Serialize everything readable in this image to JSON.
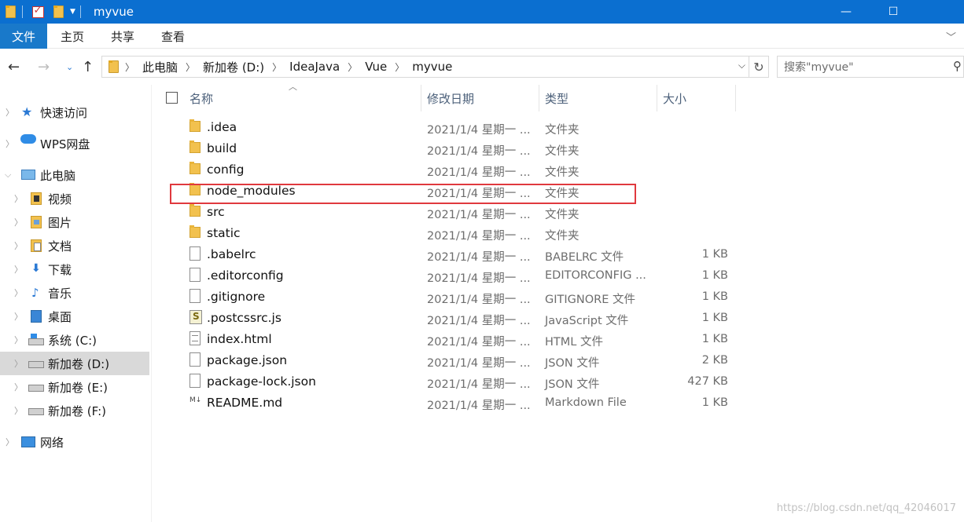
{
  "window": {
    "title": "myvue",
    "controls": {
      "minimize": "—",
      "maximize": "☐"
    }
  },
  "ribbon": {
    "tabs": [
      "文件",
      "主页",
      "共享",
      "查看"
    ]
  },
  "address": {
    "crumbs": [
      "此电脑",
      "新加卷 (D:)",
      "IdeaJava",
      "Vue",
      "myvue"
    ]
  },
  "search": {
    "placeholder": "搜索\"myvue\""
  },
  "nav": {
    "items": [
      {
        "label": "快速访问",
        "icon": "star-icon"
      },
      {
        "label": "WPS网盘",
        "icon": "cloud-icon"
      },
      {
        "label": "此电脑",
        "icon": "computer-icon"
      },
      {
        "label": "视频",
        "icon": "video-library-icon"
      },
      {
        "label": "图片",
        "icon": "picture-library-icon"
      },
      {
        "label": "文档",
        "icon": "document-library-icon"
      },
      {
        "label": "下载",
        "icon": "download-icon"
      },
      {
        "label": "音乐",
        "icon": "music-icon"
      },
      {
        "label": "桌面",
        "icon": "desktop-icon"
      },
      {
        "label": "系统 (C:)",
        "icon": "system-drive-icon"
      },
      {
        "label": "新加卷 (D:)",
        "icon": "drive-icon"
      },
      {
        "label": "新加卷 (E:)",
        "icon": "drive-icon"
      },
      {
        "label": "新加卷 (F:)",
        "icon": "drive-icon"
      },
      {
        "label": "网络",
        "icon": "network-icon"
      }
    ]
  },
  "columns": {
    "name": "名称",
    "date": "修改日期",
    "type": "类型",
    "size": "大小"
  },
  "files": [
    {
      "name": ".idea",
      "date": "2021/1/4 星期一 ...",
      "type": "文件夹",
      "size": "",
      "kind": "folder"
    },
    {
      "name": "build",
      "date": "2021/1/4 星期一 ...",
      "type": "文件夹",
      "size": "",
      "kind": "folder"
    },
    {
      "name": "config",
      "date": "2021/1/4 星期一 ...",
      "type": "文件夹",
      "size": "",
      "kind": "folder"
    },
    {
      "name": "node_modules",
      "date": "2021/1/4 星期一 ...",
      "type": "文件夹",
      "size": "",
      "kind": "folder"
    },
    {
      "name": "src",
      "date": "2021/1/4 星期一 ...",
      "type": "文件夹",
      "size": "",
      "kind": "folder"
    },
    {
      "name": "static",
      "date": "2021/1/4 星期一 ...",
      "type": "文件夹",
      "size": "",
      "kind": "folder"
    },
    {
      "name": ".babelrc",
      "date": "2021/1/4 星期一 ...",
      "type": "BABELRC 文件",
      "size": "1 KB",
      "kind": "file"
    },
    {
      "name": ".editorconfig",
      "date": "2021/1/4 星期一 ...",
      "type": "EDITORCONFIG ...",
      "size": "1 KB",
      "kind": "file"
    },
    {
      "name": ".gitignore",
      "date": "2021/1/4 星期一 ...",
      "type": "GITIGNORE 文件",
      "size": "1 KB",
      "kind": "file"
    },
    {
      "name": ".postcssrc.js",
      "date": "2021/1/4 星期一 ...",
      "type": "JavaScript 文件",
      "size": "1 KB",
      "kind": "js"
    },
    {
      "name": "index.html",
      "date": "2021/1/4 星期一 ...",
      "type": "HTML 文件",
      "size": "1 KB",
      "kind": "html"
    },
    {
      "name": "package.json",
      "date": "2021/1/4 星期一 ...",
      "type": "JSON 文件",
      "size": "2 KB",
      "kind": "file"
    },
    {
      "name": "package-lock.json",
      "date": "2021/1/4 星期一 ...",
      "type": "JSON 文件",
      "size": "427 KB",
      "kind": "file"
    },
    {
      "name": "README.md",
      "date": "2021/1/4 星期一 ...",
      "type": "Markdown File",
      "size": "1 KB",
      "kind": "md"
    }
  ],
  "watermark": "https://blog.csdn.net/qq_42046017",
  "colors": {
    "titlebar": "#0b6fd0",
    "file_tab": "#1979ca",
    "highlight": "#e0393e"
  }
}
